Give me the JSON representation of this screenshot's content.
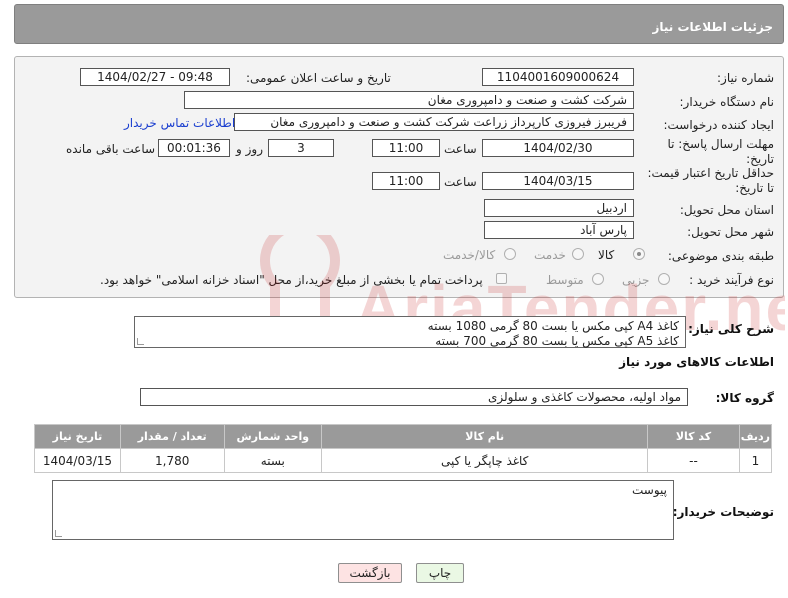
{
  "header": {
    "title": "جزئیات اطلاعات نیاز"
  },
  "form": {
    "need_number": {
      "label": "شماره نیاز:",
      "value": "1104001609000624"
    },
    "announce": {
      "label": "تاریخ و ساعت اعلان عمومی:",
      "value": "1404/02/27 - 09:48"
    },
    "buyer": {
      "label": "نام دستگاه خریدار:",
      "value": "شرکت کشت و صنعت و دامپروری مغان"
    },
    "creator": {
      "label": "ایجاد کننده درخواست:",
      "value": "فریبرز فیروزی کارپرداز زراعت شرکت کشت و صنعت و دامپروری مغان",
      "contact_link": "اطلاعات تماس خریدار"
    },
    "deadline": {
      "label_line1": "مهلت ارسال پاسخ: تا",
      "label_line2": "تاریخ:",
      "date": "1404/02/30",
      "time_label": "ساعت",
      "time": "11:00",
      "days": "3",
      "days_label": "روز و",
      "remaining": "00:01:36",
      "remaining_label": "ساعت باقی مانده"
    },
    "validity": {
      "label_line1": "حداقل تاریخ اعتبار قیمت:",
      "label_line2": "تا تاریخ:",
      "date": "1404/03/15",
      "time_label": "ساعت",
      "time": "11:00"
    },
    "province": {
      "label": "استان محل تحویل:",
      "value": "اردبیل"
    },
    "city": {
      "label": "شهر محل تحویل:",
      "value": "پارس آباد"
    },
    "category": {
      "label": "طبقه بندی موضوعی:",
      "options": [
        "کالا",
        "خدمت",
        "کالا/خدمت"
      ],
      "selected": "کالا"
    },
    "process": {
      "label": "نوع فرآیند خرید :",
      "options": [
        "جزیی",
        "متوسط"
      ],
      "payment_note": "پرداخت تمام یا بخشی از مبلغ خرید،از محل \"اسناد خزانه اسلامی\" خواهد بود."
    }
  },
  "description": {
    "label": "شرح کلی نیاز:",
    "line1": "کاغذ A4 کپی مکس یا بست 80 گرمی 1080 بسته",
    "line2": "کاغذ A5 کپی مکس یا بست 80 گرمی 700   بسته"
  },
  "goods_section": {
    "title": "اطلاعات کالاهای مورد نیاز"
  },
  "goods_group": {
    "label": "گروه کالا:",
    "value": "مواد اولیه، محصولات کاغذی و سلولزی"
  },
  "table": {
    "headers": [
      "ردیف",
      "کد کالا",
      "نام کالا",
      "واحد شمارش",
      "تعداد / مقدار",
      "تاریخ نیاز"
    ],
    "rows": [
      [
        "1",
        "--",
        "کاغذ چاپگر یا کپی",
        "بسته",
        "1,780",
        "1404/03/15"
      ]
    ]
  },
  "buyer_notes": {
    "label": "توضیحات خریدار:",
    "value": "پیوست"
  },
  "buttons": {
    "print": "چاپ",
    "back": "بازگشت"
  },
  "watermark": {
    "text": "AriaTender.neT"
  },
  "colors": {
    "header_bg": "#9a9a9a",
    "link": "#1a3ecf",
    "back_button_bg": "#fde3e3",
    "print_button_bg": "#eaf8e4"
  }
}
